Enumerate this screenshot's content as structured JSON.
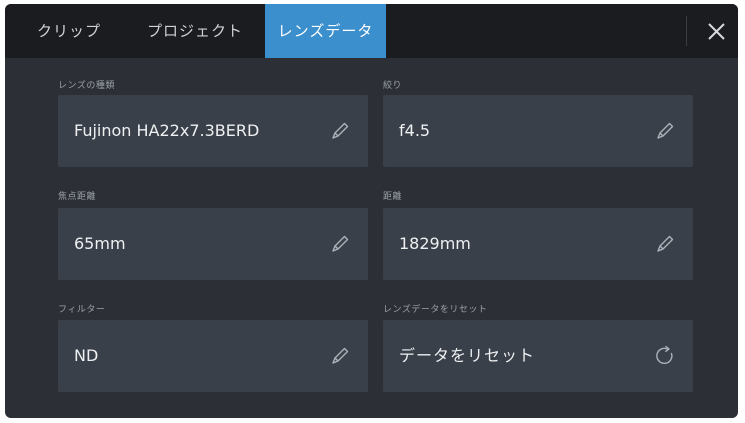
{
  "tabs": [
    {
      "label": "クリップ",
      "active": false
    },
    {
      "label": "プロジェクト",
      "active": false
    },
    {
      "label": "レンズデータ",
      "active": true
    }
  ],
  "close_icon": "close-icon",
  "fields": {
    "lens_type": {
      "label": "レンズの種類",
      "value": "Fujinon HA22x7.3BERD",
      "icon": "pencil-icon"
    },
    "iris": {
      "label": "絞り",
      "value": "f4.5",
      "icon": "pencil-icon"
    },
    "focal_length": {
      "label": "焦点距離",
      "value": "65mm",
      "icon": "pencil-icon"
    },
    "distance": {
      "label": "距離",
      "value": "1829mm",
      "icon": "pencil-icon"
    },
    "filter": {
      "label": "フィルター",
      "value": "ND",
      "icon": "pencil-icon"
    },
    "reset": {
      "label": "レンズデータをリセット",
      "value": "データをリセット",
      "icon": "reset-icon"
    }
  },
  "colors": {
    "accent": "#3c8fcd",
    "background": "#2c3036",
    "topbar": "#1b1c1f",
    "field": "#3a4049"
  }
}
